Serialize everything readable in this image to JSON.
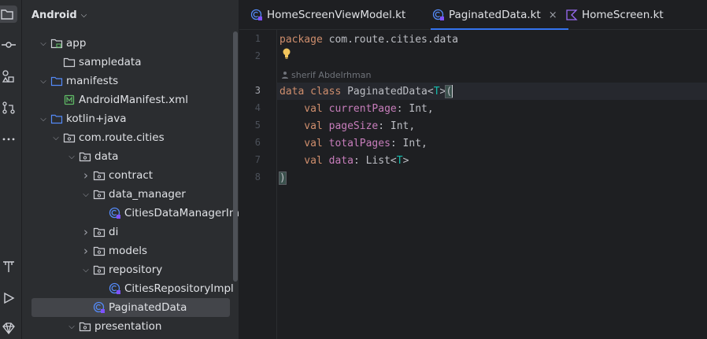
{
  "project_panel": {
    "title": "Android",
    "tree": [
      {
        "label": "app",
        "arrow": "down",
        "icon": "module-folder-icon"
      },
      {
        "label": "sampledata",
        "arrow": "",
        "icon": "folder-icon"
      },
      {
        "label": "manifests",
        "arrow": "down",
        "icon": "folder-blue-icon"
      },
      {
        "label": "AndroidManifest.xml",
        "arrow": "",
        "icon": "manifest-file-icon"
      },
      {
        "label": "kotlin+java",
        "arrow": "down",
        "icon": "folder-blue-icon"
      },
      {
        "label": "com.route.cities",
        "arrow": "down",
        "icon": "package-icon"
      },
      {
        "label": "data",
        "arrow": "down",
        "icon": "package-icon"
      },
      {
        "label": "contract",
        "arrow": "right",
        "icon": "package-icon"
      },
      {
        "label": "data_manager",
        "arrow": "down",
        "icon": "package-icon"
      },
      {
        "label": "CitiesDataManagerIm",
        "arrow": "",
        "icon": "kotlin-class-icon"
      },
      {
        "label": "di",
        "arrow": "right",
        "icon": "package-icon"
      },
      {
        "label": "models",
        "arrow": "right",
        "icon": "package-icon"
      },
      {
        "label": "repository",
        "arrow": "down",
        "icon": "package-icon"
      },
      {
        "label": "CitiesRepositoryImpl",
        "arrow": "",
        "icon": "kotlin-class-icon"
      },
      {
        "label": "PaginatedData",
        "arrow": "",
        "icon": "kotlin-class-icon",
        "selected": true
      },
      {
        "label": "presentation",
        "arrow": "down",
        "icon": "package-icon"
      }
    ]
  },
  "tabs": [
    {
      "label": "HomeScreenViewModel.kt",
      "icon": "kotlin-class-icon"
    },
    {
      "label": "PaginatedData.kt",
      "icon": "kotlin-class-icon",
      "active": true,
      "close": "×"
    },
    {
      "label": "HomeScreen.kt",
      "icon": "kotlin-file-icon"
    }
  ],
  "editor": {
    "line_numbers": [
      "1",
      "2",
      "3",
      "4",
      "5",
      "6",
      "7",
      "8"
    ],
    "current_line": "3",
    "author_hint": "sherif Abdelrhman",
    "code": {
      "l1_kw": "package",
      "l1_rest": " com.route.cities.data",
      "l3_kw": "data class",
      "l3_name": " PaginatedData<",
      "l3_tp": "T",
      "l3_close": ">",
      "l3_paren": "(",
      "l4_kw": "    val",
      "l4_prop": " currentPage",
      "l4_rest": ": Int,",
      "l5_kw": "    val",
      "l5_prop": " pageSize",
      "l5_rest": ": Int,",
      "l6_kw": "    val",
      "l6_prop": " totalPages",
      "l6_rest": ": Int,",
      "l7_kw": "    val",
      "l7_prop": " data",
      "l7_rest": ": List<",
      "l7_tp": "T",
      "l7_end": ">",
      "l8": ")"
    }
  },
  "colors": {
    "accent": "#3574f0",
    "keyword": "#cf8e6d",
    "property": "#c77dbb",
    "type_param": "#16baac"
  }
}
